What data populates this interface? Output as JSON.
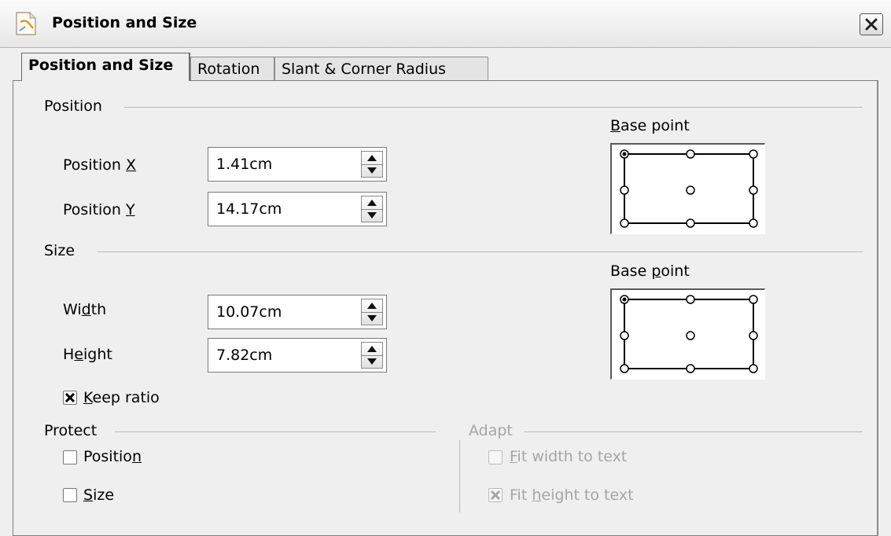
{
  "window": {
    "title": "Position and Size"
  },
  "tabs": [
    {
      "label": "Position and Size",
      "active": true
    },
    {
      "label": "Rotation",
      "active": false
    },
    {
      "label": "Slant & Corner Radius",
      "active": false
    }
  ],
  "position": {
    "heading": "Position",
    "x_label_pre": "Position ",
    "x_label_key": "X",
    "x_value": "1.41cm",
    "y_label_pre": "Position ",
    "y_label_key": "Y",
    "y_value": "14.17cm",
    "base_point_key": "B",
    "base_point_rest": "ase point"
  },
  "size": {
    "heading": "Size",
    "width_pre": "Wi",
    "width_key": "d",
    "width_post": "th",
    "width_value": "10.07cm",
    "height_pre": "H",
    "height_key": "e",
    "height_post": "ight",
    "height_value": "7.82cm",
    "keep_ratio_key": "K",
    "keep_ratio_rest": "eep ratio",
    "keep_ratio_checked": true,
    "base_point_pre": "Base ",
    "base_point_key": "p",
    "base_point_post": "oint"
  },
  "protect": {
    "heading": "Protect",
    "position_pre": "Positio",
    "position_key": "n",
    "size_key": "S",
    "size_rest": "ize"
  },
  "adapt": {
    "heading": "Adapt",
    "fit_width_key": "F",
    "fit_width_rest": "it width to text",
    "fit_height_pre": "Fit ",
    "fit_height_key": "h",
    "fit_height_post": "eight to text",
    "fit_height_checked": true
  },
  "icons": {
    "app": "draw-document-icon",
    "close": "close-icon",
    "spin_up": "triangle-up-icon",
    "spin_down": "triangle-down-icon"
  },
  "colors": {
    "disabled_text": "#a5a5a5",
    "window_bg": "#efefef"
  }
}
